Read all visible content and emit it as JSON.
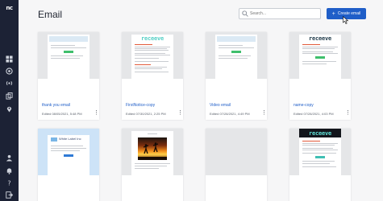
{
  "sidebar": {
    "logo": "nc",
    "items": [
      "layout-icon",
      "target-icon",
      "broadcast-icon",
      "copy-icon",
      "location-pin-icon"
    ],
    "bottom_items": [
      "user-group-icon",
      "bell-icon",
      "help-icon",
      "logout-icon"
    ]
  },
  "header": {
    "title": "Email",
    "search_placeholder": "Search...",
    "create_label": "Create email",
    "accent": "#1f5ec8"
  },
  "cards": [
    {
      "title": "thank you email",
      "meta": "Edited 08/05/2021, 5:48 PM"
    },
    {
      "title": "FirstNotice-copy",
      "meta": "Edited 07/30/2021, 2:25 PM",
      "brand": "receeve"
    },
    {
      "title": "Video email",
      "meta": "Edited 07/28/2021, 4:49 PM"
    },
    {
      "title": "name-copy",
      "meta": "Edited 07/28/2021, 4:03 PM",
      "brand": "receeve"
    },
    {
      "title": "",
      "meta": "",
      "banner_text": "White Label Inc"
    },
    {
      "title": "",
      "meta": ""
    },
    {
      "title": "",
      "meta": ""
    },
    {
      "title": "",
      "meta": "",
      "brand": "receeve"
    }
  ]
}
